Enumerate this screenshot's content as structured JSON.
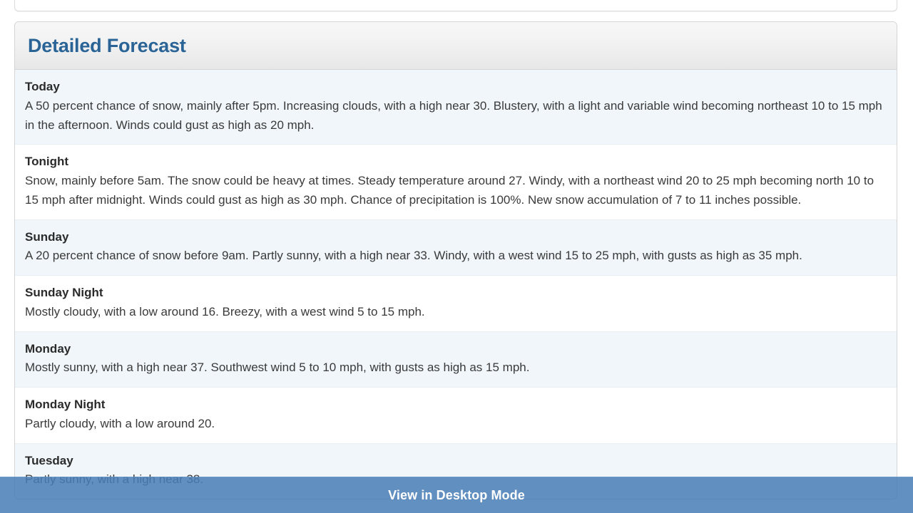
{
  "panel": {
    "title": "Detailed Forecast",
    "title_color": "#2a6496",
    "rows": [
      {
        "name": "Today",
        "text": "A 50 percent chance of snow, mainly after 5pm. Increasing clouds, with a high near 30. Blustery, with a light and variable wind becoming northeast 10 to 15 mph in the afternoon. Winds could gust as high as 20 mph."
      },
      {
        "name": "Tonight",
        "text": "Snow, mainly before 5am. The snow could be heavy at times. Steady temperature around 27. Windy, with a northeast wind 20 to 25 mph becoming north 10 to 15 mph after midnight. Winds could gust as high as 30 mph. Chance of precipitation is 100%. New snow accumulation of 7 to 11 inches possible."
      },
      {
        "name": "Sunday",
        "text": "A 20 percent chance of snow before 9am. Partly sunny, with a high near 33. Windy, with a west wind 15 to 25 mph, with gusts as high as 35 mph."
      },
      {
        "name": "Sunday Night",
        "text": "Mostly cloudy, with a low around 16. Breezy, with a west wind 5 to 15 mph."
      },
      {
        "name": "Monday",
        "text": "Mostly sunny, with a high near 37. Southwest wind 5 to 10 mph, with gusts as high as 15 mph."
      },
      {
        "name": "Monday Night",
        "text": "Partly cloudy, with a low around 20."
      },
      {
        "name": "Tuesday",
        "text": "Partly sunny, with a high near 38."
      }
    ]
  },
  "footer": {
    "desktop_mode_label": "View in Desktop Mode",
    "bar_color": "#487eb6"
  }
}
